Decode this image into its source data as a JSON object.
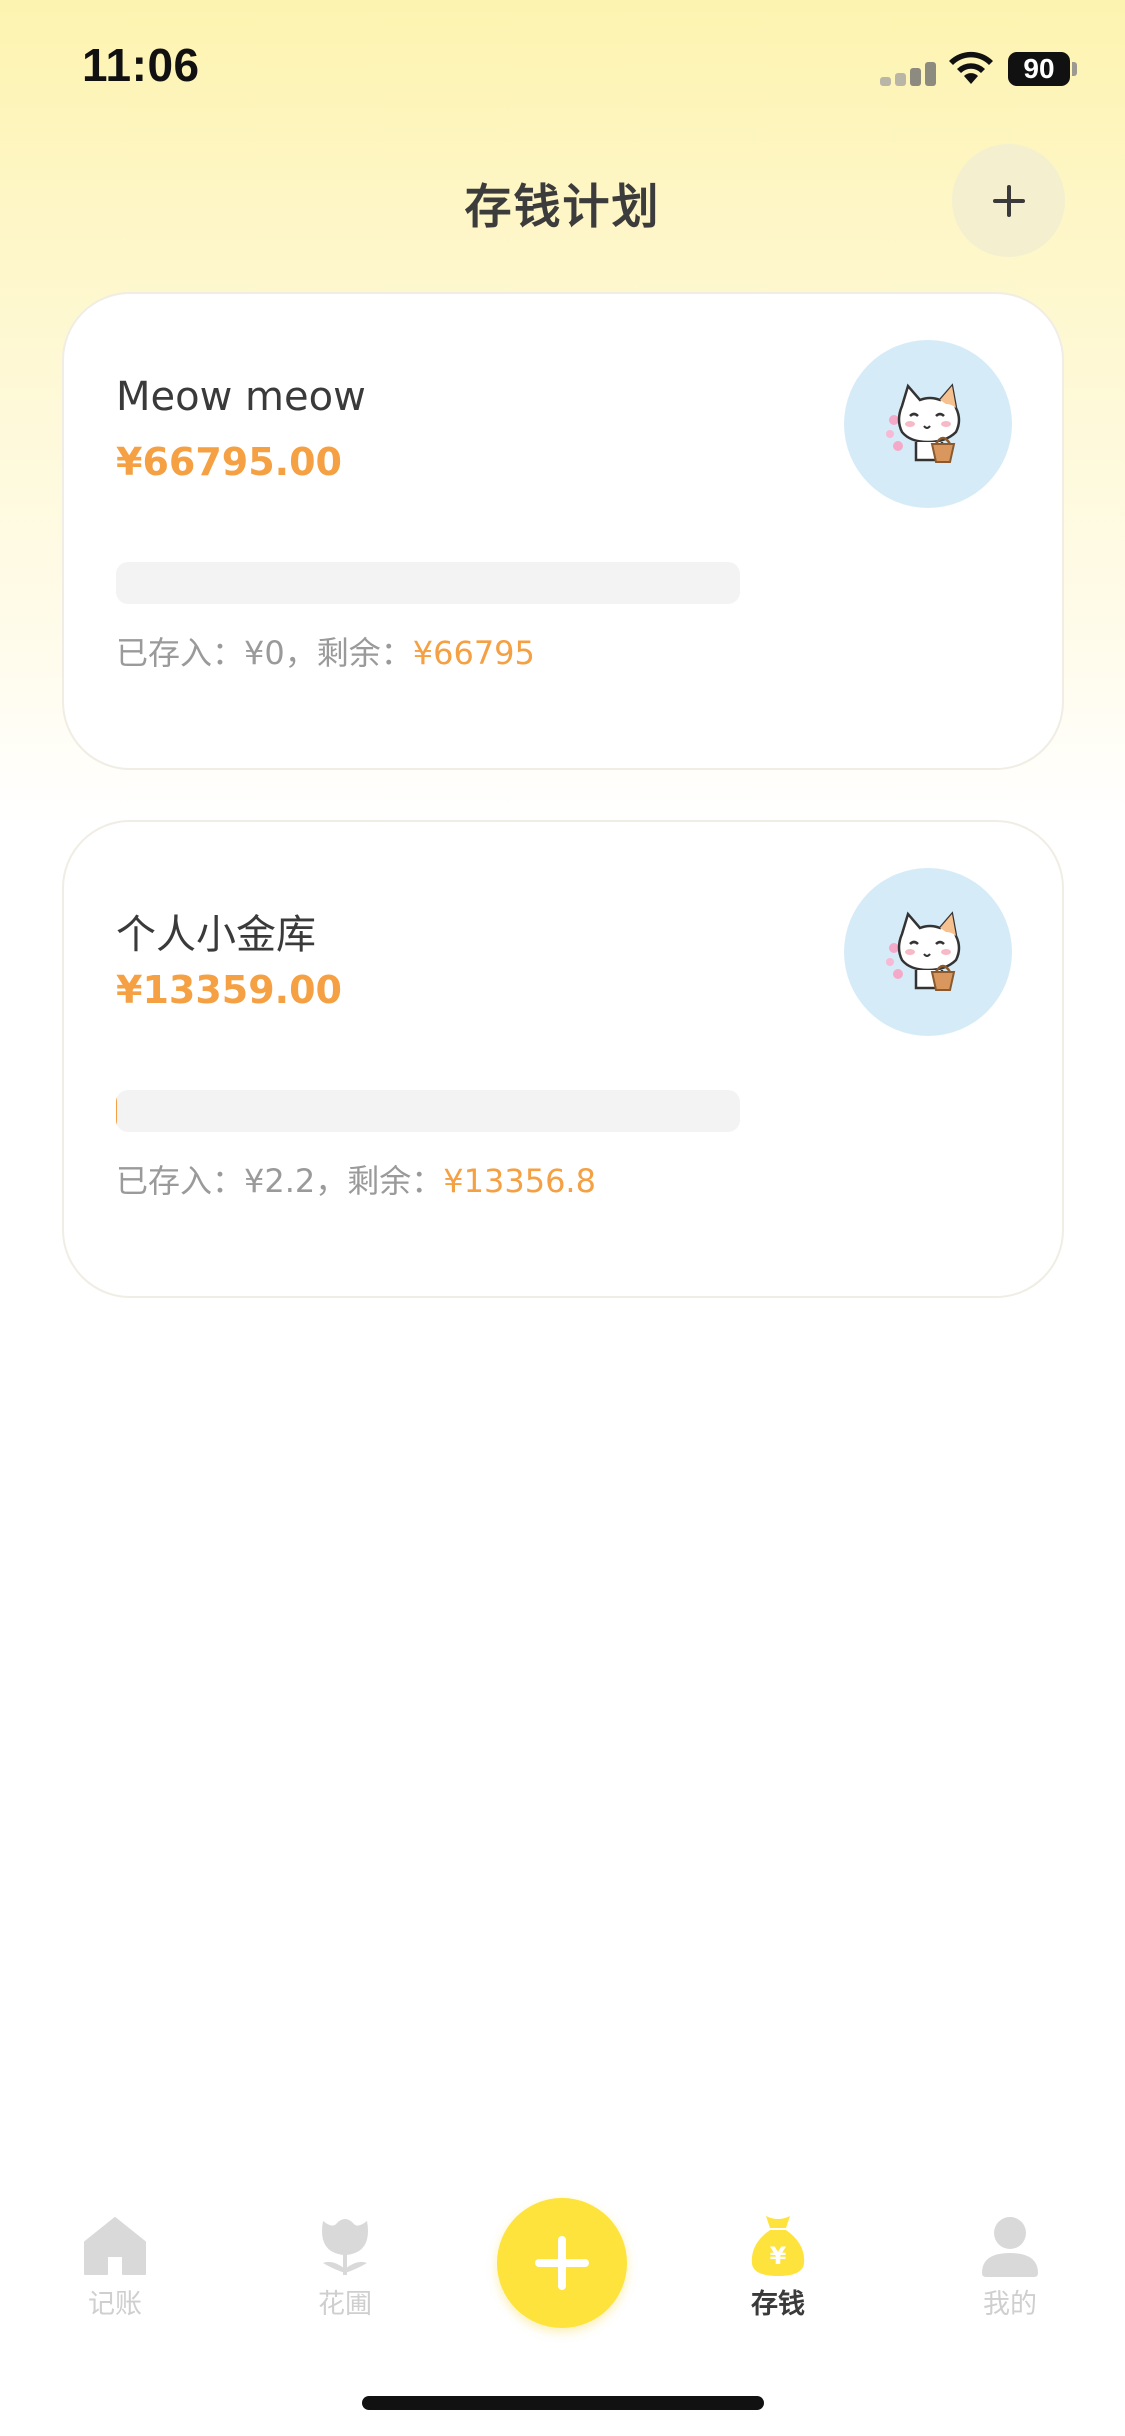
{
  "status_bar": {
    "time": "11:06",
    "battery": "90"
  },
  "header": {
    "title": "存钱计划",
    "add_icon": "plus-icon"
  },
  "plans": [
    {
      "name": "Meow meow",
      "amount": "¥66795.00",
      "progress_fraction": 0,
      "saved_label": "已存入：¥0，剩余：",
      "remaining": "¥66795",
      "avatar_icon": "cat-avatar-icon"
    },
    {
      "name": "个人小金库",
      "amount": "¥13359.00",
      "progress_fraction": 0.0002,
      "saved_label": "已存入：¥2.2，剩余：",
      "remaining": "¥13356.8",
      "avatar_icon": "cat-avatar-icon"
    }
  ],
  "tab_bar": {
    "tabs": [
      {
        "label": "记账",
        "icon": "home-icon",
        "active": false
      },
      {
        "label": "花圃",
        "icon": "flower-icon",
        "active": false
      },
      {
        "label": "存钱",
        "icon": "money-bag-icon",
        "active": true
      },
      {
        "label": "我的",
        "icon": "person-icon",
        "active": false
      }
    ],
    "center_icon": "plus-icon"
  },
  "colors": {
    "accent_orange": "#f4a043",
    "accent_yellow": "#fde33c",
    "avatar_bg": "#d6ebf8",
    "header_gradient": "#fdf3b0"
  }
}
